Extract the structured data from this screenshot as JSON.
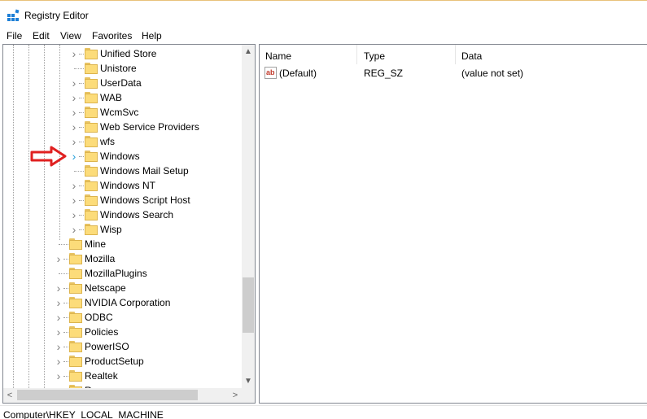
{
  "window": {
    "title": "Registry Editor"
  },
  "menu": [
    "File",
    "Edit",
    "View",
    "Favorites",
    "Help"
  ],
  "tree": {
    "children": [
      {
        "label": "Unified Store",
        "expandable": true
      },
      {
        "label": "Unistore",
        "expandable": false
      },
      {
        "label": "UserData",
        "expandable": true
      },
      {
        "label": "WAB",
        "expandable": true
      },
      {
        "label": "WcmSvc",
        "expandable": true
      },
      {
        "label": "Web Service Providers",
        "expandable": true
      },
      {
        "label": "wfs",
        "expandable": true
      },
      {
        "label": "Windows",
        "expandable": true,
        "selected": true
      },
      {
        "label": "Windows Mail Setup",
        "expandable": false
      },
      {
        "label": "Windows NT",
        "expandable": true
      },
      {
        "label": "Windows Script Host",
        "expandable": true
      },
      {
        "label": "Windows Search",
        "expandable": true
      },
      {
        "label": "Wisp",
        "expandable": true
      }
    ],
    "siblings": [
      {
        "label": "Mine",
        "expandable": false
      },
      {
        "label": "Mozilla",
        "expandable": true
      },
      {
        "label": "MozillaPlugins",
        "expandable": false
      },
      {
        "label": "Netscape",
        "expandable": true
      },
      {
        "label": "NVIDIA Corporation",
        "expandable": true
      },
      {
        "label": "ODBC",
        "expandable": true
      },
      {
        "label": "Policies",
        "expandable": true
      },
      {
        "label": "PowerISO",
        "expandable": true
      },
      {
        "label": "ProductSetup",
        "expandable": true
      },
      {
        "label": "Realtek",
        "expandable": true
      },
      {
        "label": "Reg",
        "expandable": true
      }
    ]
  },
  "values": {
    "columns": [
      "Name",
      "Type",
      "Data"
    ],
    "rows": [
      {
        "name": "(Default)",
        "type": "REG_SZ",
        "data": "(value not set)",
        "icon": "string-value-icon"
      }
    ]
  },
  "status": {
    "path": "Computer\\HKEY_LOCAL_MACHINE"
  },
  "colors": {
    "annotation_arrow": "#e02020",
    "selection_chevron": "#26a0da",
    "folder": "#fcdc7a"
  },
  "icons": {
    "app": "registry-editor-icon",
    "folder": "folder-icon",
    "chevron": "chevron-right-icon",
    "annotation": "red-arrow-icon"
  }
}
